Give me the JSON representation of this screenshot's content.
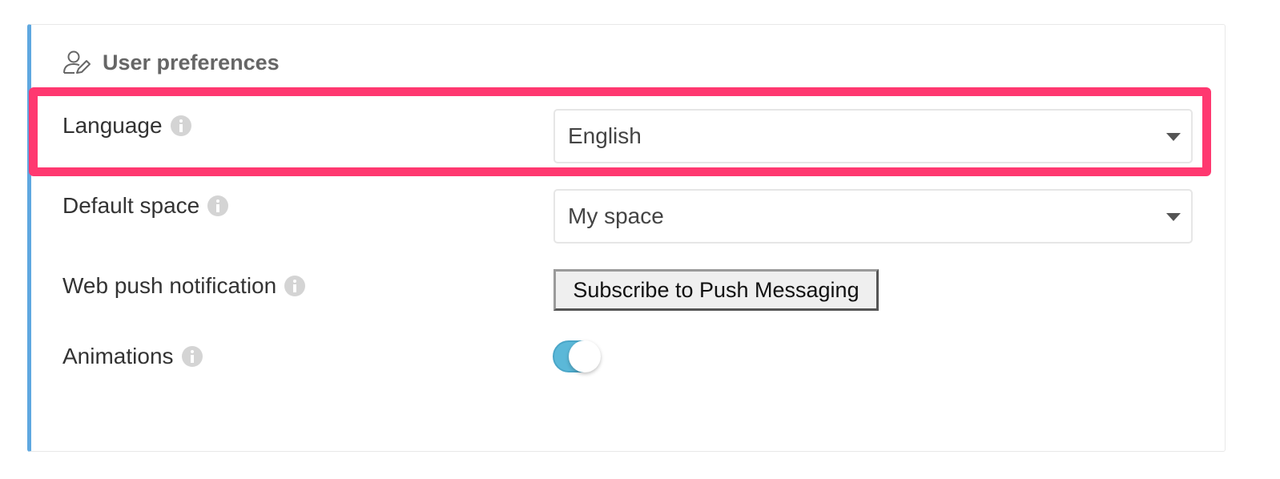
{
  "header": {
    "icon": "user-edit-icon",
    "title": "User preferences"
  },
  "preferences": {
    "language": {
      "label": "Language",
      "info_icon": "info-icon",
      "selected_value": "English"
    },
    "default_space": {
      "label": "Default space",
      "info_icon": "info-icon",
      "selected_value": "My space"
    },
    "web_push": {
      "label": "Web push notification",
      "info_icon": "info-icon",
      "button_label": "Subscribe to Push Messaging"
    },
    "animations": {
      "label": "Animations",
      "info_icon": "info-icon",
      "enabled": true
    }
  },
  "colors": {
    "card_accent": "#5fa8e0",
    "highlight": "#ff3870",
    "toggle_on": "#5bb8d8"
  }
}
